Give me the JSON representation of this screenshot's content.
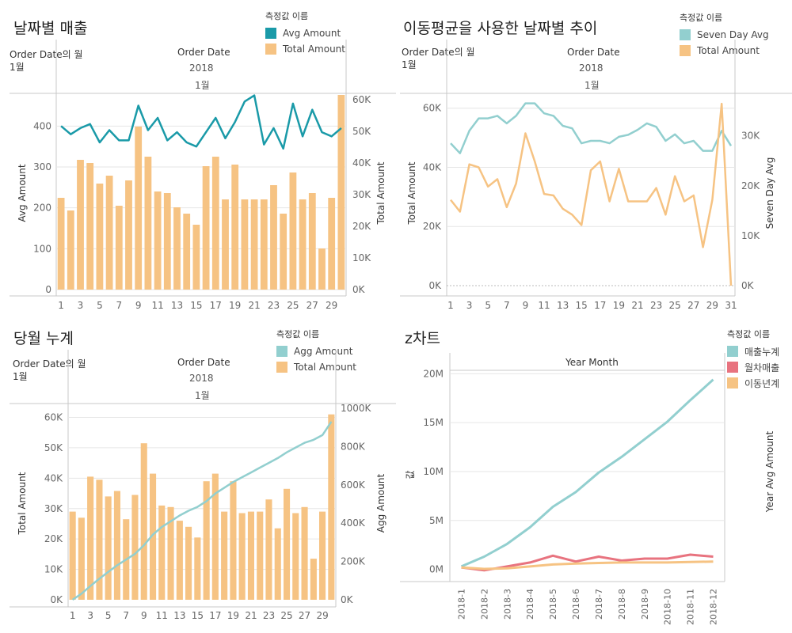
{
  "panels": {
    "p1": {
      "title": "날짜별 매출",
      "legend_title": "측정값 이름",
      "legend": [
        "Avg Amount",
        "Total Amount"
      ],
      "row_header": "Order Date의 월",
      "row_value": "1월",
      "col_header": "Order Date",
      "col_year": "2018",
      "col_month": "1월",
      "left_axis": "Avg Amount",
      "right_axis": "Total Amount",
      "left_ticks": [
        "0",
        "100",
        "200",
        "300",
        "400"
      ],
      "right_ticks": [
        "0K",
        "10K",
        "20K",
        "30K",
        "40K",
        "50K",
        "60K"
      ],
      "x_ticks": [
        "1",
        "3",
        "5",
        "7",
        "9",
        "11",
        "13",
        "15",
        "17",
        "19",
        "21",
        "23",
        "25",
        "27",
        "29"
      ]
    },
    "p2": {
      "title": "이동평균을 사용한 날짜별 추이",
      "legend_title": "측정값 이름",
      "legend": [
        "Seven Day Avg",
        "Total Amount"
      ],
      "row_header": "Order Date의 월",
      "row_value": "1월",
      "col_header": "Order Date",
      "col_year": "2018",
      "col_month": "1월",
      "left_axis": "Total Amount",
      "right_axis": "Seven Day Avg",
      "left_ticks": [
        "0K",
        "20K",
        "40K",
        "60K"
      ],
      "right_ticks": [
        "0K",
        "10K",
        "20K",
        "30K"
      ],
      "x_ticks": [
        "1",
        "3",
        "5",
        "7",
        "9",
        "11",
        "13",
        "15",
        "17",
        "19",
        "21",
        "23",
        "25",
        "27",
        "29",
        "31"
      ]
    },
    "p3": {
      "title": "당월 누계",
      "legend_title": "측정값 이름",
      "legend": [
        "Agg Amount",
        "Total Amount"
      ],
      "row_header": "Order Date의 월",
      "row_value": "1월",
      "col_header": "Order Date",
      "col_year": "2018",
      "col_month": "1월",
      "left_axis": "Total Amount",
      "right_axis": "Agg Amount",
      "left_ticks": [
        "0K",
        "10K",
        "20K",
        "30K",
        "40K",
        "50K",
        "60K"
      ],
      "right_ticks": [
        "0K",
        "200K",
        "400K",
        "600K",
        "800K",
        "1000K"
      ],
      "x_ticks": [
        "1",
        "3",
        "5",
        "7",
        "9",
        "11",
        "13",
        "15",
        "17",
        "19",
        "21",
        "23",
        "25",
        "27",
        "29"
      ]
    },
    "p4": {
      "title": "z차트",
      "legend_title": "측정값 이름",
      "legend": [
        "매출누계",
        "월차매출",
        "이동년계"
      ],
      "col_header": "Year Month",
      "left_axis": "값",
      "right_axis": "Year Avg Amount",
      "left_ticks": [
        "0M",
        "5M",
        "10M",
        "15M",
        "20M"
      ],
      "x_ticks": [
        "2018-1",
        "2018-2",
        "2018-3",
        "2018-4",
        "2018-5",
        "2018-6",
        "2018-7",
        "2018-8",
        "2018-9",
        "2018-10",
        "2018-11",
        "2018-12"
      ]
    }
  },
  "colors": {
    "teal": "#1a9aa8",
    "light_teal": "#92cfcf",
    "orange": "#f6c383",
    "pink": "#e8737f",
    "grid": "#e6e6e6",
    "axis": "#c8c8c8"
  },
  "chart_data": [
    {
      "type": "bar",
      "title": "날짜별 매출",
      "x": [
        1,
        2,
        3,
        4,
        5,
        6,
        7,
        8,
        9,
        10,
        11,
        12,
        13,
        14,
        15,
        16,
        17,
        18,
        19,
        20,
        21,
        22,
        23,
        24,
        25,
        26,
        27,
        28,
        29,
        30
      ],
      "series": [
        {
          "name": "Total Amount",
          "axis": "right",
          "values": [
            29000,
            25000,
            41000,
            40000,
            33500,
            36000,
            26500,
            34500,
            51500,
            42000,
            31000,
            30500,
            26000,
            24000,
            20500,
            39000,
            42000,
            28500,
            39500,
            28500,
            28500,
            28500,
            33000,
            24000,
            37000,
            28500,
            30500,
            13000,
            29000,
            61500
          ]
        },
        {
          "name": "Avg Amount",
          "axis": "left",
          "type": "line",
          "values": [
            400,
            380,
            395,
            405,
            360,
            390,
            365,
            365,
            450,
            390,
            420,
            365,
            385,
            360,
            350,
            385,
            420,
            370,
            410,
            460,
            475,
            355,
            395,
            345,
            455,
            375,
            440,
            385,
            375,
            395
          ]
        }
      ],
      "left_range": [
        0,
        480
      ],
      "right_range": [
        0,
        62000
      ]
    },
    {
      "type": "line",
      "title": "이동평균을 사용한 날짜별 추이",
      "x": [
        1,
        2,
        3,
        4,
        5,
        6,
        7,
        8,
        9,
        10,
        11,
        12,
        13,
        14,
        15,
        16,
        17,
        18,
        19,
        20,
        21,
        22,
        23,
        24,
        25,
        26,
        27,
        28,
        29,
        30,
        31
      ],
      "series": [
        {
          "name": "Seven Day Avg",
          "axis": "right",
          "values": [
            28500,
            26500,
            31000,
            33500,
            33500,
            34000,
            32500,
            34000,
            36500,
            36500,
            34500,
            34000,
            32000,
            31500,
            28500,
            29000,
            29000,
            28500,
            29800,
            30200,
            31200,
            32500,
            31800,
            29000,
            30300,
            28500,
            29000,
            27000,
            27000,
            31000,
            28000
          ]
        },
        {
          "name": "Total Amount",
          "axis": "left",
          "values": [
            29000,
            25000,
            41000,
            40000,
            33500,
            36000,
            26500,
            34500,
            51500,
            42000,
            31000,
            30500,
            26000,
            24000,
            20500,
            39000,
            42000,
            28500,
            39500,
            28500,
            28500,
            28500,
            33000,
            24000,
            37000,
            28500,
            30500,
            13000,
            29000,
            61500,
            0
          ]
        }
      ],
      "left_range": [
        0,
        65000
      ],
      "right_range": [
        0,
        38500
      ]
    },
    {
      "type": "bar",
      "title": "당월 누계",
      "x": [
        1,
        2,
        3,
        4,
        5,
        6,
        7,
        8,
        9,
        10,
        11,
        12,
        13,
        14,
        15,
        16,
        17,
        18,
        19,
        20,
        21,
        22,
        23,
        24,
        25,
        26,
        27,
        28,
        29,
        30
      ],
      "series": [
        {
          "name": "Total Amount",
          "axis": "left",
          "values": [
            29000,
            27000,
            40500,
            39500,
            34000,
            35800,
            26500,
            34500,
            51500,
            41500,
            31000,
            30500,
            26000,
            24000,
            20500,
            39000,
            41500,
            29000,
            39000,
            28500,
            29000,
            29000,
            33000,
            23500,
            36500,
            28500,
            30500,
            13500,
            29000,
            61000
          ]
        },
        {
          "name": "Agg Amount",
          "axis": "right",
          "type": "line",
          "values": [
            0,
            32000,
            72000,
            110000,
            146000,
            180000,
            210000,
            240000,
            285000,
            340000,
            380000,
            410000,
            440000,
            465000,
            485000,
            515000,
            555000,
            585000,
            615000,
            640000,
            665000,
            690000,
            715000,
            740000,
            770000,
            795000,
            820000,
            835000,
            860000,
            930000
          ]
        }
      ],
      "left_range": [
        0,
        63000
      ],
      "right_range": [
        0,
        1000000
      ]
    },
    {
      "type": "line",
      "title": "z차트",
      "categories": [
        "2018-1",
        "2018-2",
        "2018-3",
        "2018-4",
        "2018-5",
        "2018-6",
        "2018-7",
        "2018-8",
        "2018-9",
        "2018-10",
        "2018-11",
        "2018-12"
      ],
      "series": [
        {
          "name": "매출누계",
          "values": [
            300000,
            1300000,
            2600000,
            4300000,
            6400000,
            7900000,
            9900000,
            11500000,
            13300000,
            15100000,
            17300000,
            19400000
          ]
        },
        {
          "name": "월차매출",
          "values": [
            200000,
            -100000,
            300000,
            700000,
            1400000,
            800000,
            1300000,
            900000,
            1100000,
            1100000,
            1500000,
            1300000
          ]
        },
        {
          "name": "이동년계",
          "values": [
            200000,
            50000,
            100000,
            300000,
            500000,
            600000,
            650000,
            700000,
            700000,
            700000,
            750000,
            800000
          ]
        }
      ],
      "ylim": [
        -600000,
        21000000
      ]
    }
  ]
}
